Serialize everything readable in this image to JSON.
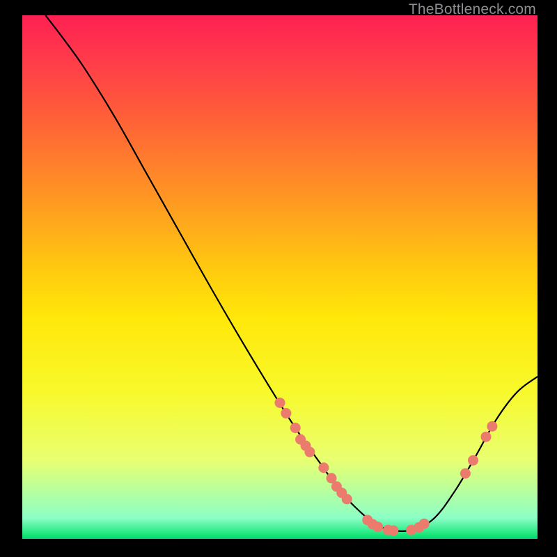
{
  "watermark": "TheBottleneck.com",
  "colors": {
    "background": "#000000",
    "curve": "#000000",
    "dot_fill": "#ea7b6d",
    "dot_stroke": "#c96154",
    "gradient_top": "#ff2052",
    "gradient_bottom": "#00d96c"
  },
  "chart_data": {
    "type": "line",
    "title": "",
    "xlabel": "",
    "ylabel": "",
    "xlim": [
      0,
      100
    ],
    "ylim": [
      0,
      100
    ],
    "note": "Y axis reads as percentage height from bottom of plot; X axis reads as percentage across plot width. Values are estimated from pixel positions (no axis ticks present).",
    "series": [
      {
        "name": "curve",
        "points": [
          {
            "x": 4.5,
            "y": 100.0
          },
          {
            "x": 8.0,
            "y": 95.5
          },
          {
            "x": 12.0,
            "y": 90.0
          },
          {
            "x": 18.0,
            "y": 80.5
          },
          {
            "x": 24.0,
            "y": 70.0
          },
          {
            "x": 30.0,
            "y": 59.5
          },
          {
            "x": 36.0,
            "y": 49.0
          },
          {
            "x": 42.0,
            "y": 38.8
          },
          {
            "x": 48.0,
            "y": 29.0
          },
          {
            "x": 53.0,
            "y": 21.2
          },
          {
            "x": 58.0,
            "y": 14.2
          },
          {
            "x": 62.0,
            "y": 8.8
          },
          {
            "x": 66.0,
            "y": 4.8
          },
          {
            "x": 69.0,
            "y": 2.6
          },
          {
            "x": 72.0,
            "y": 1.6
          },
          {
            "x": 76.0,
            "y": 1.8
          },
          {
            "x": 80.0,
            "y": 4.0
          },
          {
            "x": 84.0,
            "y": 9.2
          },
          {
            "x": 88.0,
            "y": 15.8
          },
          {
            "x": 92.0,
            "y": 22.8
          },
          {
            "x": 96.0,
            "y": 28.0
          },
          {
            "x": 100.0,
            "y": 31.0
          }
        ]
      }
    ],
    "highlight_points": [
      {
        "x": 50.0,
        "y": 26.0
      },
      {
        "x": 51.2,
        "y": 24.0
      },
      {
        "x": 53.0,
        "y": 21.2
      },
      {
        "x": 54.0,
        "y": 19.0
      },
      {
        "x": 55.0,
        "y": 17.8
      },
      {
        "x": 55.8,
        "y": 16.6
      },
      {
        "x": 58.5,
        "y": 13.6
      },
      {
        "x": 60.0,
        "y": 11.6
      },
      {
        "x": 61.0,
        "y": 10.0
      },
      {
        "x": 62.0,
        "y": 8.8
      },
      {
        "x": 63.0,
        "y": 7.6
      },
      {
        "x": 67.0,
        "y": 3.6
      },
      {
        "x": 68.0,
        "y": 2.8
      },
      {
        "x": 69.0,
        "y": 2.3
      },
      {
        "x": 71.0,
        "y": 1.7
      },
      {
        "x": 72.0,
        "y": 1.6
      },
      {
        "x": 75.5,
        "y": 1.7
      },
      {
        "x": 77.0,
        "y": 2.2
      },
      {
        "x": 78.0,
        "y": 2.9
      },
      {
        "x": 86.0,
        "y": 12.5
      },
      {
        "x": 87.5,
        "y": 15.0
      },
      {
        "x": 90.0,
        "y": 19.5
      },
      {
        "x": 91.2,
        "y": 21.5
      }
    ]
  }
}
